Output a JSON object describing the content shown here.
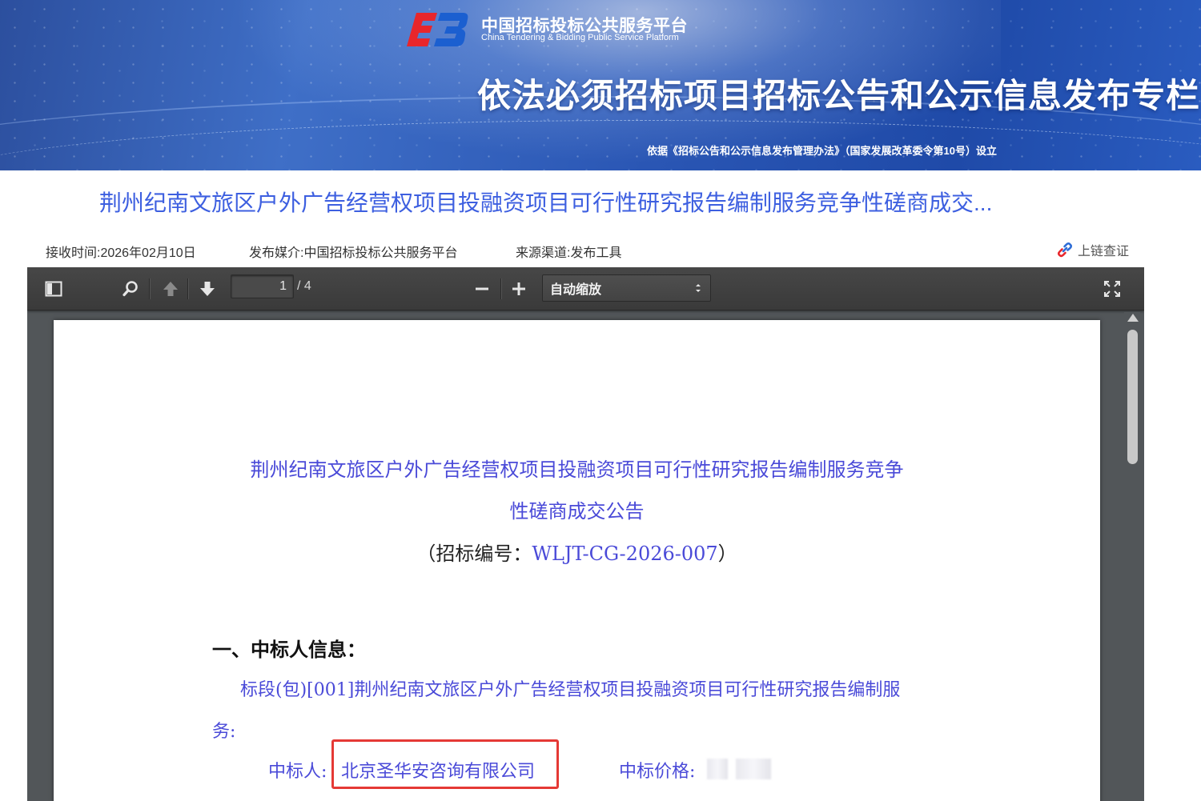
{
  "banner": {
    "logo_cn": "中国招标投标公共服务平台",
    "logo_en": "China Tendering & Bidding Public Service Platform",
    "title": "依法必须招标项目招标公告和公示信息发布专栏",
    "subtitle": "依据《招标公告和公示信息发布管理办法》（国家发展改革委令第10号）设立"
  },
  "page": {
    "title": "荆州纪南文旅区户外广告经营权项目投融资项目可行性研究报告编制服务竞争性磋商成交...",
    "receive_time": "接收时间:2026年02月10日",
    "media": "发布媒介:中国招标投标公共服务平台",
    "channel": "来源渠道:发布工具",
    "chain_verify": "上链查证"
  },
  "viewer": {
    "page_current": "1",
    "page_total": "/ 4",
    "zoom": "自动缩放",
    "icons": {
      "sidebar": "sidebar-toggle-icon",
      "search": "search-icon",
      "prev": "arrow-up-icon",
      "next": "arrow-down-icon",
      "zoom_out": "minus-icon",
      "zoom_in": "plus-icon",
      "fullscreen": "fullscreen-icon"
    }
  },
  "document": {
    "title_line1": "荆州纪南文旅区户外广告经营权项目投融资项目可行性研究报告编制服务竞争",
    "title_line2": "性磋商成交公告",
    "code_prefix": "（招标编号：",
    "code_value": "WLJT-CG-2026-007",
    "code_suffix": "）",
    "section1": "一、中标人信息：",
    "lot_line1": "标段(包)[001]荆州纪南文旅区户外广告经营权项目投融资项目可行性研究报告编制服",
    "lot_line2": "务:",
    "winner_label": "中标人:",
    "winner_value": "北京圣华安咨询有限公司",
    "price_label": "中标价格:"
  },
  "colors": {
    "link_blue": "#3d5fe0",
    "doc_blue": "#4a4ad8",
    "highlight_red": "#e53935",
    "viewer_bg": "#525659"
  }
}
